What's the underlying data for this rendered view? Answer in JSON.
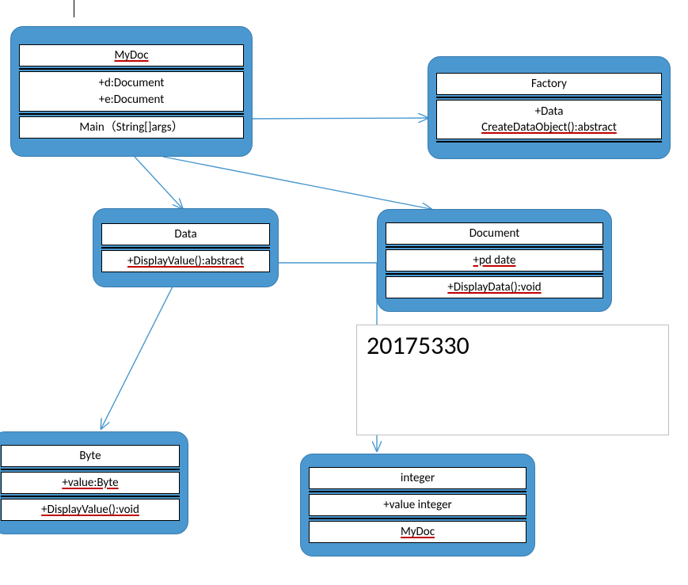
{
  "annotation": "20175330",
  "classes": {
    "mydoc": {
      "name": "MyDoc",
      "attrs": [
        "+d:Document",
        "+e:Document"
      ],
      "ops": [
        "Main（String[]args）"
      ]
    },
    "factory": {
      "name": "Factory",
      "attrs": [],
      "ops": [
        "+Data",
        "CreateDataObject():abstract"
      ]
    },
    "data": {
      "name": "Data",
      "attrs": [],
      "ops": [
        "+DisplayValue():abstract"
      ]
    },
    "document": {
      "name": "Document",
      "attrs": [
        "+pd date"
      ],
      "ops": [
        "+DisplayData():void"
      ]
    },
    "byte": {
      "name": "Byte",
      "attrs": [
        "+value:Byte"
      ],
      "ops": [
        "+DisplayValue():void"
      ]
    },
    "integer": {
      "name": "integer",
      "attrs": [
        "+value integer"
      ],
      "ops": [
        "MyDoc"
      ]
    }
  }
}
